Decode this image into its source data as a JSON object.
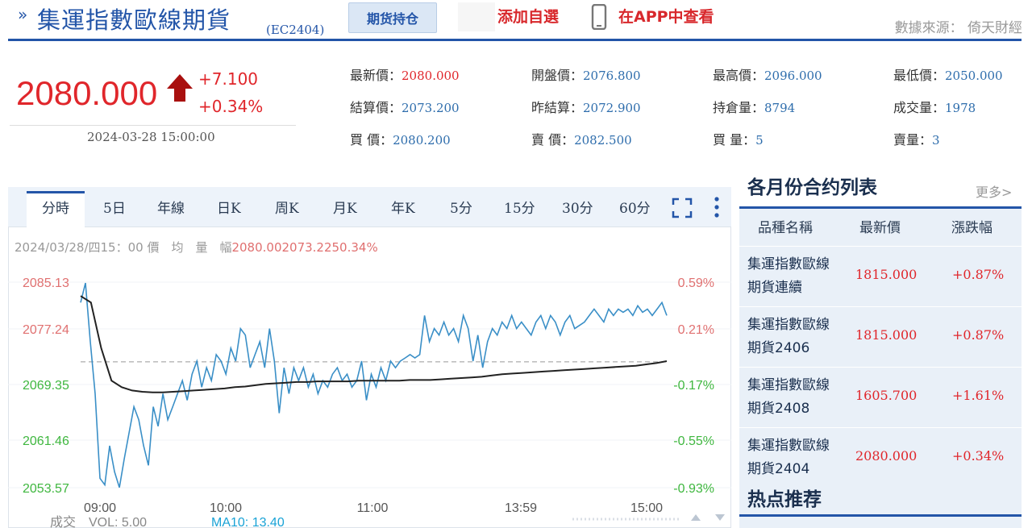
{
  "header": {
    "title_arrow": "»",
    "title": "集運指數歐線期貨",
    "code": "(EC2404)",
    "holdings_button": "期货持仓",
    "add_watch": "添加自選",
    "app_link": "在APP中查看",
    "source": "數據來源： 倚天財經"
  },
  "quote": {
    "last_price": "2080.000",
    "change": "+7.100",
    "change_pct": "+0.34%",
    "timestamp": "2024-03-28 15:00:00",
    "fields": [
      {
        "label": "最新價：",
        "value": "2080.000",
        "color": "#e0262b"
      },
      {
        "label": "開盤價：",
        "value": "2076.800",
        "color": "#2e6dac"
      },
      {
        "label": "最高價：",
        "value": "2096.000",
        "color": "#2e6dac"
      },
      {
        "label": "最低價：",
        "value": "2050.000",
        "color": "#2e6dac"
      },
      {
        "label": "結算價：",
        "value": "2073.200",
        "color": "#2e6dac"
      },
      {
        "label": "昨結算：",
        "value": "2072.900",
        "color": "#2e6dac"
      },
      {
        "label": "持倉量：",
        "value": "8794",
        "color": "#2e6dac"
      },
      {
        "label": "成交量：",
        "value": "1978",
        "color": "#2e6dac"
      },
      {
        "label": "買 價：",
        "value": "2080.200",
        "color": "#2e6dac"
      },
      {
        "label": "賣 價：",
        "value": "2082.500",
        "color": "#2e6dac"
      },
      {
        "label": "買 量：",
        "value": "5",
        "color": "#2e6dac"
      },
      {
        "label": "賣量：",
        "value": "3",
        "color": "#2e6dac"
      }
    ]
  },
  "tabs": [
    "分時",
    "5日",
    "年線",
    "日K",
    "周K",
    "月K",
    "年K",
    "5分",
    "15分",
    "30分",
    "60分"
  ],
  "active_tab": "分時",
  "info_line": {
    "prefix": "2024/03/28/四15：00 價　均　量　幅",
    "values": "2080.002073.2250.34%"
  },
  "volume_line": {
    "vol_label": "成交　VOL: 5.00",
    "ma_label": "MA10: 13.40"
  },
  "chart_data": {
    "type": "line",
    "y_left_ticks": [
      "2085.13",
      "2077.24",
      "2069.35",
      "2061.46",
      "2053.57"
    ],
    "y_right_ticks": [
      "0.59%",
      "0.21%",
      "-0.17%",
      "-0.55%",
      "-0.93%"
    ],
    "x_ticks": [
      "09:00",
      "10:00",
      "11:00",
      "13:59",
      "15:00"
    ],
    "ylim": [
      2053.57,
      2085.13
    ],
    "reference_price": 2072.9,
    "series": [
      {
        "color": "#3a8fc7",
        "values": [
          2082,
          2085,
          2076,
          2068,
          2055,
          2054,
          2060,
          2056,
          2053.6,
          2058,
          2062,
          2066,
          2064,
          2060,
          2057,
          2066,
          2063,
          2068,
          2064,
          2066,
          2068,
          2070,
          2067,
          2071,
          2073,
          2069,
          2072,
          2070,
          2074,
          2073,
          2071,
          2075,
          2073,
          2078,
          2077,
          2072,
          2074,
          2076,
          2072,
          2078,
          2073,
          2065,
          2072,
          2068,
          2072,
          2070,
          2072,
          2069,
          2071,
          2068,
          2070,
          2069,
          2071,
          2072,
          2070,
          2071,
          2069,
          2070,
          2073,
          2067,
          2071,
          2069,
          2072,
          2070,
          2073,
          2072,
          2073,
          2073.5,
          2074,
          2073.5,
          2074,
          2080,
          2076,
          2078,
          2077,
          2079,
          2077,
          2078,
          2076,
          2080,
          2078,
          2073,
          2077,
          2072,
          2076,
          2078,
          2077,
          2079,
          2078,
          2080,
          2078,
          2079,
          2078,
          2077,
          2079,
          2080,
          2078,
          2080,
          2079,
          2077,
          2079,
          2080,
          2078,
          2078.5,
          2079,
          2080,
          2081,
          2080,
          2079,
          2081,
          2080,
          2081,
          2080.5,
          2081,
          2080,
          2081.5,
          2080.5,
          2081,
          2080,
          2081,
          2082,
          2080
        ]
      },
      {
        "color": "#222222",
        "values": [
          2083,
          2082,
          2075,
          2070,
          2069,
          2068.5,
          2068.3,
          2068.2,
          2068.2,
          2068.3,
          2068.4,
          2068.5,
          2068.6,
          2068.7,
          2068.8,
          2069,
          2069.1,
          2069.3,
          2069.5,
          2069.6,
          2069.7,
          2069.8,
          2069.8,
          2069.9,
          2069.9,
          2069.9,
          2069.9,
          2070,
          2070,
          2070,
          2070,
          2070,
          2070.1,
          2070.1,
          2070.1,
          2070.2,
          2070.3,
          2070.4,
          2070.5,
          2070.6,
          2070.8,
          2071,
          2071.1,
          2071.2,
          2071.3,
          2071.4,
          2071.5,
          2071.6,
          2071.7,
          2071.8,
          2071.9,
          2072,
          2072.1,
          2072.2,
          2072.3,
          2072.5,
          2072.7,
          2073
        ]
      }
    ]
  },
  "right_panel": {
    "title": "各月份合约列表",
    "more": "更多>",
    "headers": [
      "品種名稱",
      "最新價",
      "漲跌幅"
    ],
    "rows": [
      {
        "name": "集運指數歐線期貨連續",
        "price": "1815.000",
        "pct": "+0.87%"
      },
      {
        "name": "集運指數歐線期貨2406",
        "price": "1815.000",
        "pct": "+0.87%"
      },
      {
        "name": "集運指數歐線期貨2408",
        "price": "1605.700",
        "pct": "+1.61%"
      },
      {
        "name": "集運指數歐線期貨2404",
        "price": "2080.000",
        "pct": "+0.34%"
      }
    ],
    "hot_title": "热点推荐"
  }
}
